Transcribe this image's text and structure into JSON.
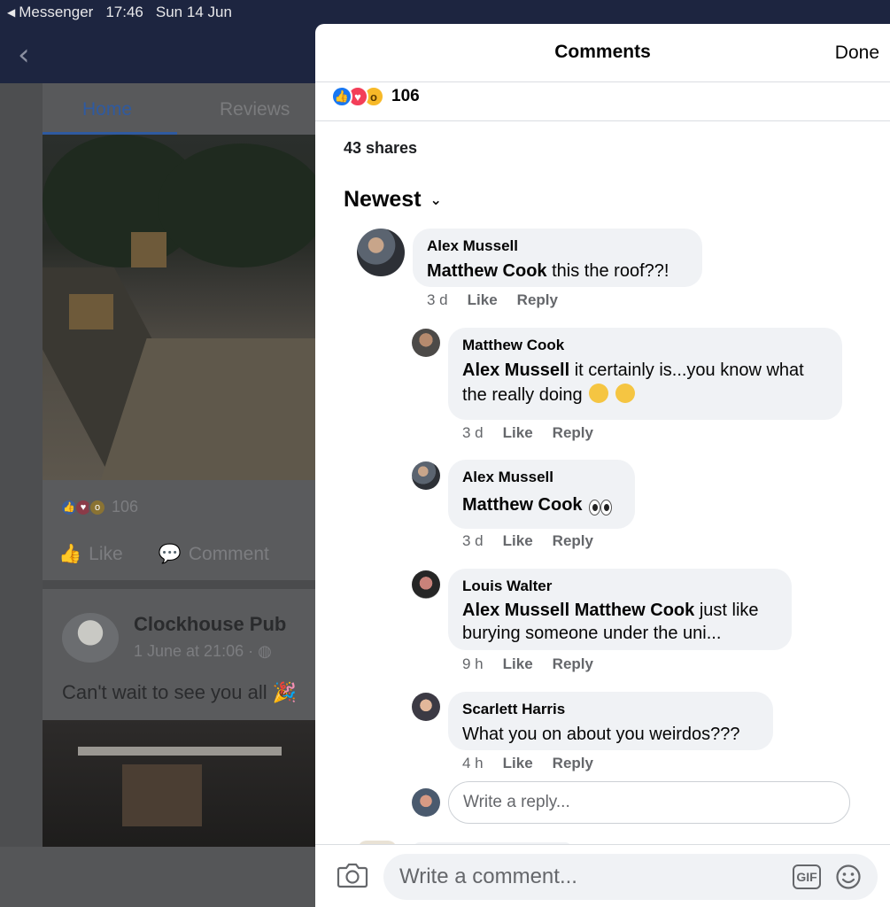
{
  "status_bar": {
    "back_app": "Messenger",
    "time": "17:46",
    "date": "Sun 14 Jun"
  },
  "background": {
    "tabs": [
      "Home",
      "Reviews"
    ],
    "post1": {
      "reaction_count": "106",
      "like_label": "Like",
      "comment_label": "Comment"
    },
    "post2": {
      "author": "Clockhouse Pub",
      "date": "1 June at 21:06 · ",
      "text": "Can't wait to see you all"
    }
  },
  "panel": {
    "title": "Comments",
    "done_label": "Done",
    "reaction_count": "106",
    "shares": "43 shares",
    "sort_label": "Newest",
    "comments": [
      {
        "author": "Alex Mussell",
        "mention": "Matthew Cook",
        "text": " this the roof??!",
        "time": "3 d",
        "like": "Like",
        "reply": "Reply"
      },
      {
        "author": "Matthew Cook",
        "mention": "Alex Mussell",
        "text": " it certainly is...you know what the really doing",
        "time": "3 d",
        "like": "Like",
        "reply": "Reply"
      },
      {
        "author": "Alex Mussell",
        "mention": "Matthew Cook",
        "text": "",
        "time": "3 d",
        "like": "Like",
        "reply": "Reply"
      },
      {
        "author": "Louis Walter",
        "mention": "Alex Mussell Matthew Cook",
        "text": " just like burying someone under the uni...",
        "time": "9 h",
        "like": "Like",
        "reply": "Reply"
      },
      {
        "author": "Scarlett Harris",
        "mention": "",
        "text": "What you on about you weirdos???",
        "time": "4 h",
        "like": "Like",
        "reply": "Reply"
      }
    ],
    "reply_placeholder": "Write a reply...",
    "comment_placeholder": "Write a comment...",
    "gif_label": "GIF"
  },
  "colors": {
    "like": "#1877f2",
    "love": "#f33e58",
    "wow": "#f7b928",
    "header_bg": "#1d2540"
  }
}
